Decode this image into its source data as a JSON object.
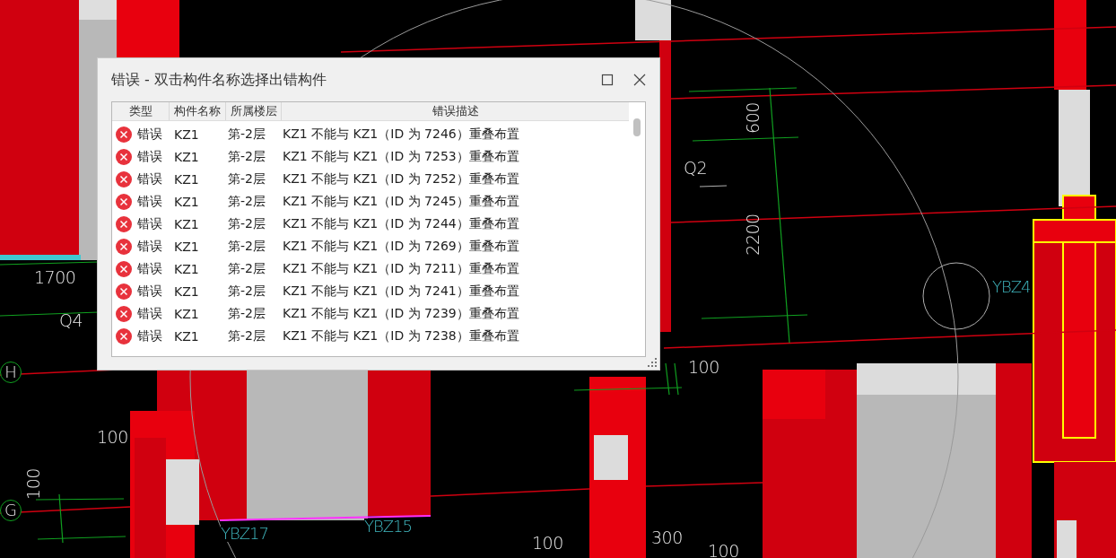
{
  "cad": {
    "labels": [
      {
        "text": "1700",
        "kind": "dimension"
      },
      {
        "text": "Q4",
        "kind": "dimension"
      },
      {
        "text": "H",
        "kind": "grid_axis"
      },
      {
        "text": "100",
        "kind": "dimension"
      },
      {
        "text": "100",
        "kind": "dimension"
      },
      {
        "text": "G",
        "kind": "grid_axis"
      },
      {
        "text": "YBZ17",
        "kind": "tag"
      },
      {
        "text": "YBZ15",
        "kind": "tag"
      },
      {
        "text": "100",
        "kind": "dimension"
      },
      {
        "text": "300",
        "kind": "dimension"
      },
      {
        "text": "100",
        "kind": "dimension"
      },
      {
        "text": "100",
        "kind": "dimension"
      },
      {
        "text": "600",
        "kind": "dimension"
      },
      {
        "text": "2200",
        "kind": "dimension"
      },
      {
        "text": "Q2",
        "kind": "dimension"
      },
      {
        "text": "YBZ4",
        "kind": "tag"
      }
    ]
  },
  "dialog": {
    "title": "错误 - 双击构件名称选择出错构件",
    "table": {
      "columns": [
        "类型",
        "构件名称",
        "所属楼层",
        "错误描述"
      ],
      "rows": [
        {
          "kind": "error",
          "type": "错误",
          "name": "KZ1",
          "floor": "第-2层",
          "description": "KZ1 不能与 KZ1（ID 为 7246）重叠布置"
        },
        {
          "kind": "error",
          "type": "错误",
          "name": "KZ1",
          "floor": "第-2层",
          "description": "KZ1 不能与 KZ1（ID 为 7253）重叠布置"
        },
        {
          "kind": "error",
          "type": "错误",
          "name": "KZ1",
          "floor": "第-2层",
          "description": "KZ1 不能与 KZ1（ID 为 7252）重叠布置"
        },
        {
          "kind": "error",
          "type": "错误",
          "name": "KZ1",
          "floor": "第-2层",
          "description": "KZ1 不能与 KZ1（ID 为 7245）重叠布置"
        },
        {
          "kind": "error",
          "type": "错误",
          "name": "KZ1",
          "floor": "第-2层",
          "description": "KZ1 不能与 KZ1（ID 为 7244）重叠布置"
        },
        {
          "kind": "error",
          "type": "错误",
          "name": "KZ1",
          "floor": "第-2层",
          "description": "KZ1 不能与 KZ1（ID 为 7269）重叠布置"
        },
        {
          "kind": "error",
          "type": "错误",
          "name": "KZ1",
          "floor": "第-2层",
          "description": "KZ1 不能与 KZ1（ID 为 7211）重叠布置"
        },
        {
          "kind": "error",
          "type": "错误",
          "name": "KZ1",
          "floor": "第-2层",
          "description": "KZ1 不能与 KZ1（ID 为 7241）重叠布置"
        },
        {
          "kind": "error",
          "type": "错误",
          "name": "KZ1",
          "floor": "第-2层",
          "description": "KZ1 不能与 KZ1（ID 为 7239）重叠布置"
        },
        {
          "kind": "error",
          "type": "错误",
          "name": "KZ1",
          "floor": "第-2层",
          "description": "KZ1 不能与 KZ1（ID 为 7238）重叠布置"
        }
      ]
    }
  }
}
